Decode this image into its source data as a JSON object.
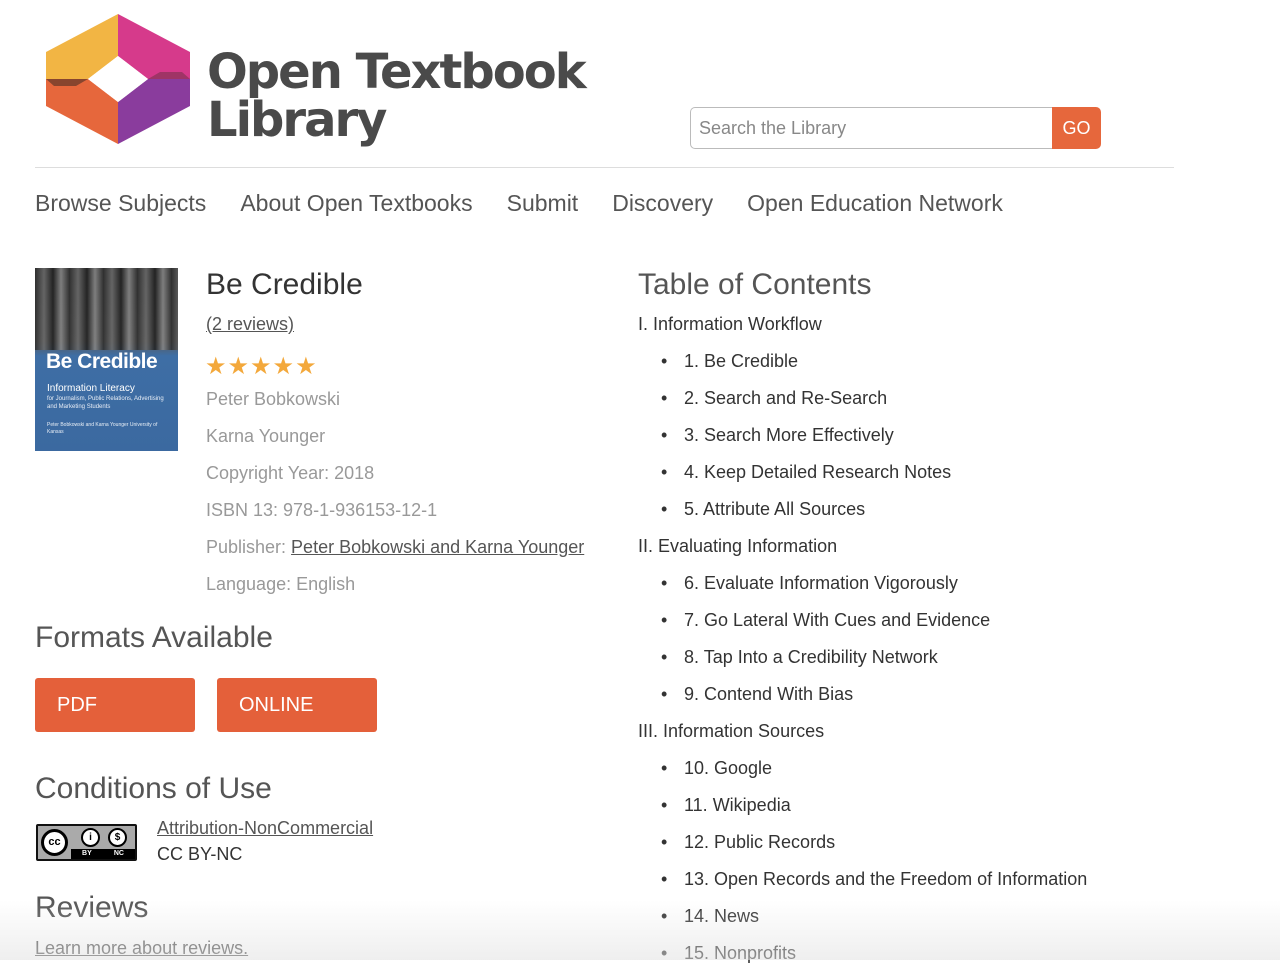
{
  "brand": {
    "line1": "Open Textbook",
    "line2": "Library",
    "colors": {
      "orange": "#e6673c",
      "yellow": "#f2b544",
      "magenta": "#d63a8b",
      "purple": "#8a3c9d"
    }
  },
  "search": {
    "placeholder": "Search the Library",
    "go_label": "GO"
  },
  "nav": [
    "Browse Subjects",
    "About Open Textbooks",
    "Submit",
    "Discovery",
    "Open Education Network"
  ],
  "cover": {
    "title": "Be Credible",
    "subtitle": "Information Literacy",
    "subtitle2": "for Journalism, Public Relations, Advertising and Marketing Students",
    "authors": "Peter Bobkowski and Karna Younger University of Kansas"
  },
  "book": {
    "title": "Be Credible",
    "reviews_link": "(2 reviews)",
    "rating": 5,
    "stars": "★★★★★",
    "author1": "Peter Bobkowski",
    "author2": "Karna Younger",
    "copyright": "Copyright Year: 2018",
    "isbn": "ISBN 13: 978-1-936153-12-1",
    "publisher_label": "Publisher: ",
    "publisher": "Peter Bobkowski and Karna Younger",
    "language": "Language: English"
  },
  "formats": {
    "heading": "Formats Available",
    "pdf": "PDF",
    "online": "ONLINE"
  },
  "conditions": {
    "heading": "Conditions of Use",
    "license_link": "Attribution-NonCommercial",
    "license_code": "CC BY-NC",
    "badge_cc": "cc",
    "badge_by": "BY",
    "badge_nc": "NC"
  },
  "reviews": {
    "heading": "Reviews",
    "learn_more": "Learn more about reviews."
  },
  "toc": {
    "heading": "Table of Contents",
    "items": [
      {
        "type": "part",
        "text": "I. Information Workflow"
      },
      {
        "type": "chapter",
        "text": "1. Be Credible"
      },
      {
        "type": "chapter",
        "text": "2. Search and Re-Search"
      },
      {
        "type": "chapter",
        "text": "3. Search More Effectively"
      },
      {
        "type": "chapter",
        "text": "4. Keep Detailed Research Notes"
      },
      {
        "type": "chapter",
        "text": "5. Attribute All Sources"
      },
      {
        "type": "part",
        "text": "II. Evaluating Information"
      },
      {
        "type": "chapter",
        "text": "6. Evaluate Information Vigorously"
      },
      {
        "type": "chapter",
        "text": "7. Go Lateral With Cues and Evidence"
      },
      {
        "type": "chapter",
        "text": "8. Tap Into a Credibility Network"
      },
      {
        "type": "chapter",
        "text": "9. Contend With Bias"
      },
      {
        "type": "part",
        "text": "III. Information Sources"
      },
      {
        "type": "chapter",
        "text": "10. Google"
      },
      {
        "type": "chapter",
        "text": "11. Wikipedia"
      },
      {
        "type": "chapter",
        "text": "12. Public Records"
      },
      {
        "type": "chapter",
        "text": "13. Open Records and the Freedom of Information"
      },
      {
        "type": "chapter",
        "text": "14. News"
      },
      {
        "type": "chapter",
        "text": "15. Nonprofits"
      }
    ]
  }
}
